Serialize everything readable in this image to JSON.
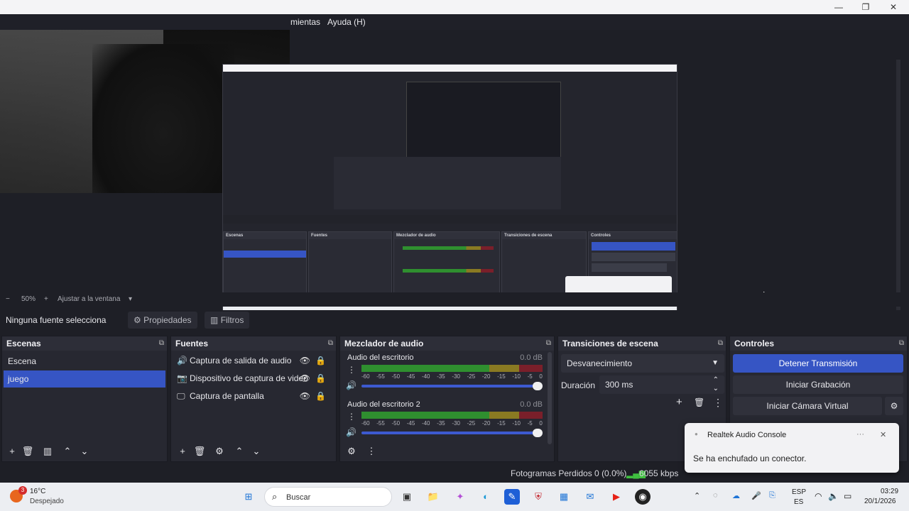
{
  "menubar": {
    "item_tools_partial": "mientas",
    "item_help": "Ayuda (H)"
  },
  "zoom": {
    "minus": "−",
    "value": "50%",
    "plus": "+",
    "fit_label": "Ajustar a la ventana",
    "chevron": "▾"
  },
  "source_bar": {
    "label": "Ninguna fuente selecciona",
    "properties": "Propiedades",
    "filters": "Filtros"
  },
  "scenes": {
    "title": "Escenas",
    "items": [
      "Escena",
      "juego"
    ],
    "selected": "juego"
  },
  "sources": {
    "title": "Fuentes",
    "items": [
      {
        "label": "Captura de salida de audio",
        "icon": "speaker-icon"
      },
      {
        "label": "Dispositivo de captura de video",
        "icon": "camera-icon"
      },
      {
        "label": "Captura de pantalla",
        "icon": "monitor-icon"
      }
    ]
  },
  "mixer": {
    "title": "Mezclador de audio",
    "channels": [
      {
        "name": "Audio del escritorio",
        "db": "0.0 dB",
        "volume_fraction": 1.0
      },
      {
        "name": "Audio del escritorio 2",
        "db": "0.0 dB",
        "volume_fraction": 1.0
      }
    ],
    "ticks": [
      "-60",
      "-55",
      "-50",
      "-45",
      "-40",
      "-35",
      "-30",
      "-25",
      "-20",
      "-15",
      "-10",
      "-5",
      "0"
    ]
  },
  "transitions": {
    "title": "Transiciones de escena",
    "selected": "Desvanecimiento",
    "duration_label": "Duración",
    "duration_value": "300 ms"
  },
  "controls": {
    "title": "Controles",
    "stop_stream": "Detener Transmisión",
    "start_recording": "Iniciar Grabación",
    "start_virtual_cam": "Iniciar Cámara Virtual"
  },
  "status": {
    "dropped_frames": "Fotogramas Perdidos 0 (0.0%)",
    "bitrate": "6055 kbps"
  },
  "toast": {
    "app": "Realtek Audio Console",
    "message": "Se ha enchufado un conector.",
    "more": "···",
    "close": "✕"
  },
  "taskbar": {
    "weather_temp": "16°C",
    "weather_desc": "Despejado",
    "weather_badge": "3",
    "search_placeholder": "Buscar",
    "lang_top": "ESP",
    "lang_bottom": "ES",
    "time": "03:29",
    "date": "20/1/2026"
  },
  "colors": {
    "accent": "#3655c4",
    "meter_green": "#2f8f2f",
    "meter_yellow": "#8a7a22",
    "meter_red": "#7a1f2a"
  }
}
